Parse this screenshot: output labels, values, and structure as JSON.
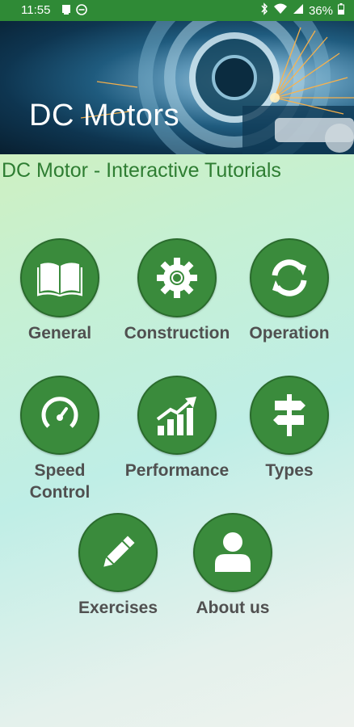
{
  "status_bar": {
    "time": "11:55",
    "battery": "36%"
  },
  "banner": {
    "title": "DC Motors"
  },
  "subtitle": "DC Motor - Interactive Tutorials",
  "menu": {
    "general": "General",
    "construction": "Construction",
    "operation": "Operation",
    "speed_control": "Speed Control",
    "performance": "Performance",
    "types": "Types",
    "exercises": "Exercises",
    "about_us": "About us"
  },
  "colors": {
    "status_bar": "#2f8a36",
    "icon_circle": "#3a8b3c",
    "subtitle": "#2e7d32",
    "label": "#505050"
  }
}
